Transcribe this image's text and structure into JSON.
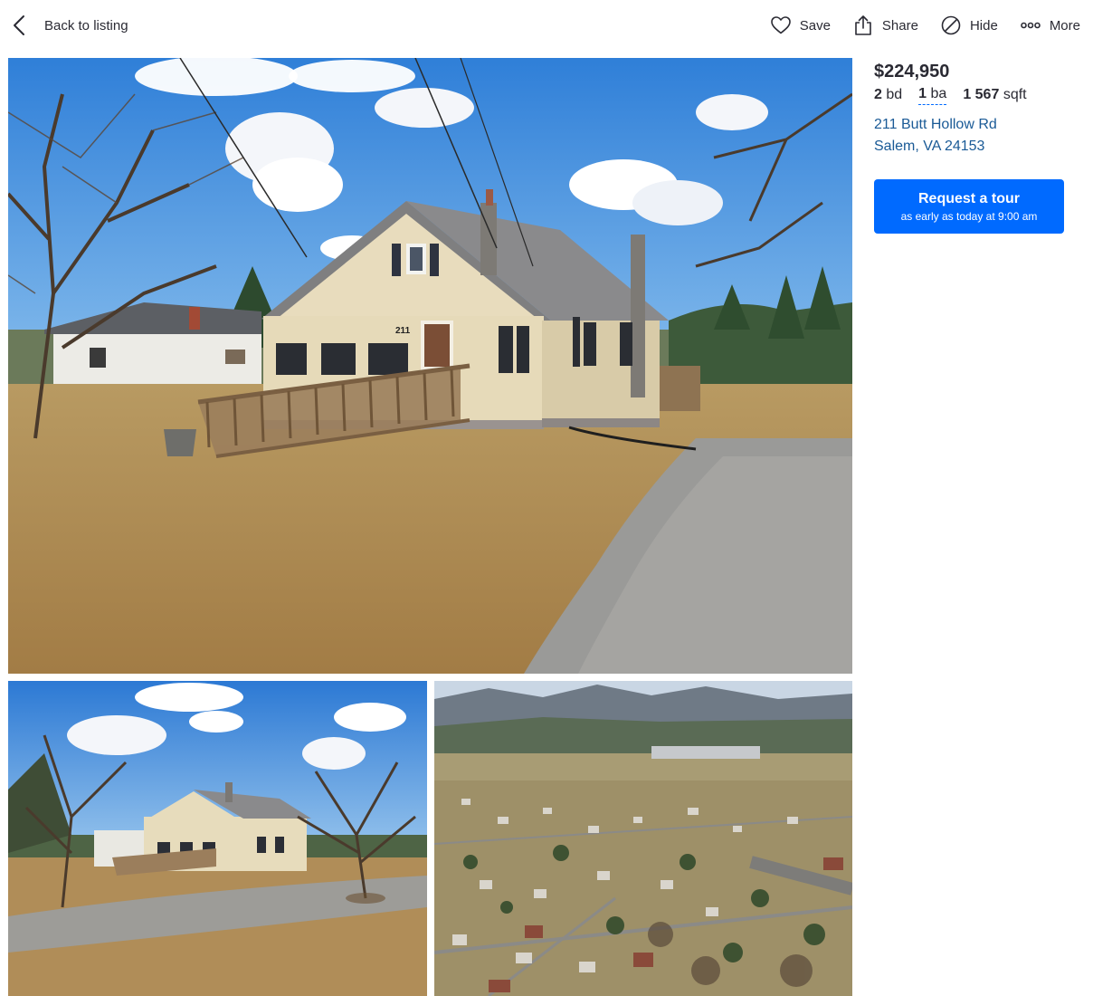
{
  "header": {
    "back_label": "Back to listing",
    "actions": {
      "save": "Save",
      "share": "Share",
      "hide": "Hide",
      "more": "More"
    }
  },
  "listing": {
    "price": "$224,950",
    "beds_value": "2",
    "beds_unit": "bd",
    "baths_value": "1",
    "baths_unit": "ba",
    "sqft_value": "1 567",
    "sqft_unit": "sqft",
    "address_line1": "211 Butt Hollow Rd",
    "address_line2": "Salem, VA 24153"
  },
  "tour_button": {
    "label": "Request a tour",
    "sublabel": "as early as today at 9:00 am"
  },
  "photos": [
    {
      "subject": "front exterior of house with ramp and gravel driveway",
      "house_number": "211"
    },
    {
      "subject": "house from yard with bare tree"
    },
    {
      "subject": "aerial view of neighborhood and mountains"
    }
  ],
  "colors": {
    "accent": "#006aff",
    "link": "#1a5a96",
    "text": "#2a2a33"
  }
}
